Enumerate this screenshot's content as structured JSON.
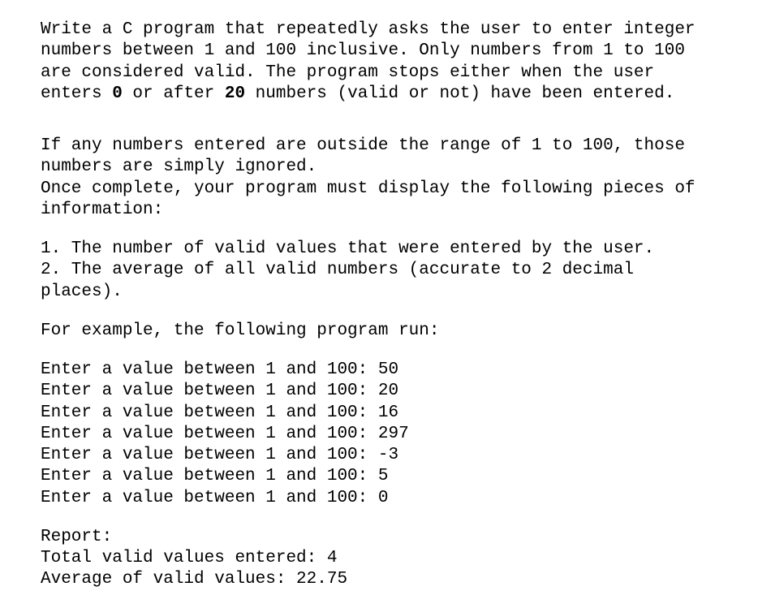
{
  "intro": {
    "pre1": "Write a C program that repeatedly asks the user to enter integer numbers between 1 and 100 inclusive. Only numbers from 1 to 100 are considered valid. The program stops either when the user enters ",
    "bold1": "0",
    "mid1": " or after ",
    "bold2": "20",
    "post1": " numbers (valid or not) have been entered."
  },
  "para2_line1": "If any numbers entered are outside the range of 1 to 100, those numbers are simply ignored.",
  "para2_line2": "Once complete, your program must display the following pieces of information:",
  "list": {
    "item1": "1. The number of valid values that were entered by the user.",
    "item2": "2. The average of all valid numbers (accurate to 2 decimal places)."
  },
  "example_lead": "For example, the following program run:",
  "prompts": [
    "Enter a value between 1 and 100: 50",
    "Enter a value between 1 and 100: 20",
    "Enter a value between 1 and 100: 16",
    "Enter a value between 1 and 100: 297",
    "Enter a value between 1 and 100: -3",
    "Enter a value between 1 and 100: 5",
    "Enter a value between 1 and 100: 0"
  ],
  "report": {
    "heading": "Report:",
    "total": "Total valid values entered: 4",
    "average": "Average of valid values: 22.75"
  }
}
